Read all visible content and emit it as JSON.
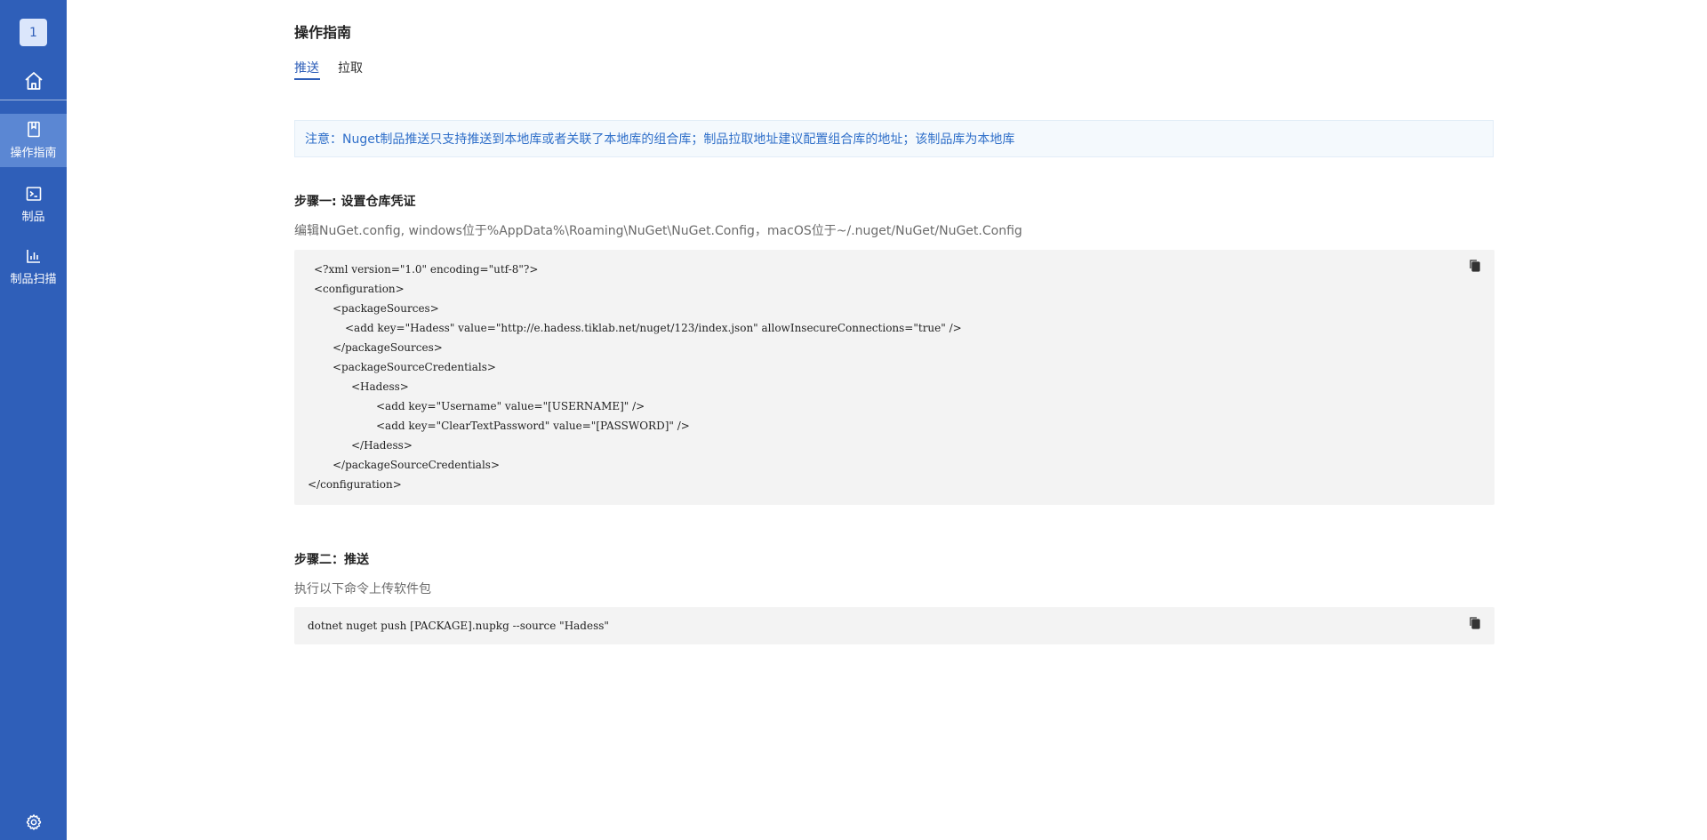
{
  "sidebar": {
    "repo_badge": "1",
    "home_icon": "home-icon",
    "items": [
      {
        "label": "操作指南",
        "icon": "guide-icon",
        "active": true
      },
      {
        "label": "制品",
        "icon": "terminal-icon",
        "active": false
      },
      {
        "label": "制品扫描",
        "icon": "bar-chart-icon",
        "active": false
      }
    ],
    "settings_icon": "gear-icon"
  },
  "page": {
    "title": "操作指南",
    "tabs": [
      {
        "label": "推送",
        "active": true
      },
      {
        "label": "拉取",
        "active": false
      }
    ]
  },
  "notice": "注意：Nuget制品推送只支持推送到本地库或者关联了本地库的组合库；制品拉取地址建议配置组合库的地址；该制品库为本地库",
  "step1": {
    "title": "步骤一: 设置仓库凭证",
    "description": "编辑NuGet.config, windows位于%AppData%\\Roaming\\NuGet\\NuGet.Config，macOS位于~/.nuget/NuGet/NuGet.Config",
    "code_lines": [
      "<?xml version=\"1.0\" encoding=\"utf-8\"?>",
      "<configuration>",
      "<packageSources>",
      "<add key=\"Hadess\" value=\"http://e.hadess.tiklab.net/nuget/123/index.json\" allowInsecureConnections=\"true\" />",
      "</packageSources>",
      "<packageSourceCredentials>",
      "<Hadess>",
      "<add key=\"Username\" value=\"[USERNAME]\" />",
      "<add key=\"ClearTextPassword\" value=\"[PASSWORD]\" />",
      "</Hadess>",
      "</packageSourceCredentials>",
      "</configuration>"
    ]
  },
  "step2": {
    "title": "步骤二：推送",
    "description": "执行以下命令上传软件包",
    "command": "dotnet nuget push [PACKAGE].nupkg --source \"Hadess\""
  },
  "colors": {
    "sidebar": "#2f5fb9",
    "sidebar_active": "#5b87d3",
    "accent": "#2f5fb9",
    "notice_text": "#2f6fc9",
    "code_bg": "#f3f3f3"
  }
}
